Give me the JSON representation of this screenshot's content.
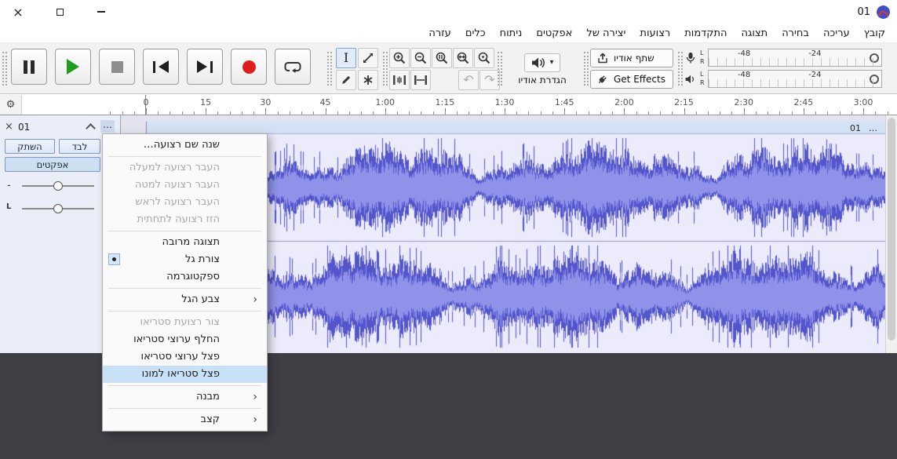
{
  "titlebar": {
    "document_title": "01",
    "close_glyph": "×"
  },
  "menubar": {
    "items": [
      "קובץ",
      "עריכה",
      "בחירה",
      "תצוגה",
      "התקדמות",
      "רצועות",
      "יצירה של",
      "אפקטים",
      "ניתוח",
      "כלים",
      "עזרה"
    ]
  },
  "toolbar": {
    "audio_setup_label": "הגדרת אודיו",
    "share_audio_label": "שתף אודיו",
    "get_effects_label": "Get Effects",
    "undo_glyph": "↶",
    "redo_glyph": "↷",
    "caret_glyph": "▾"
  },
  "meters": {
    "channels": [
      "L",
      "R"
    ],
    "scale": [
      "-48",
      "-24"
    ]
  },
  "timeline": {
    "gear_glyph": "⚙",
    "labels": [
      "0",
      "15",
      "30",
      "45",
      "1:00",
      "1:15",
      "1:30",
      "1:45",
      "2:00",
      "2:15",
      "2:30",
      "2:45",
      "3:00"
    ]
  },
  "track": {
    "close_glyph": "×",
    "name": "01",
    "menu_glyph": "…",
    "mute_label": "השתק",
    "solo_label": "לבד",
    "effects_label": "אפקטים",
    "gain_label": "-",
    "pan_label": "L",
    "clip": {
      "title": "01",
      "menu_glyph": "…"
    }
  },
  "context_menu": {
    "submenu_glyph": "›",
    "items": [
      {
        "label": "שנה שם רצועה…"
      },
      {
        "separator": true
      },
      {
        "label": "העבר רצועה למעלה",
        "disabled": true
      },
      {
        "label": "העבר רצועה למטה",
        "disabled": true
      },
      {
        "label": "העבר רצועה לראש",
        "disabled": true
      },
      {
        "label": "הזז רצועה לתחתית",
        "disabled": true
      },
      {
        "separator": true
      },
      {
        "label": "תצוגה מרובה"
      },
      {
        "label": "צורת גל",
        "radio": true
      },
      {
        "label": "ספקטוגרמה"
      },
      {
        "separator": true
      },
      {
        "label": "צבע הגל",
        "submenu": true
      },
      {
        "separator": true
      },
      {
        "label": "צור רצועת סטריאו",
        "disabled": true
      },
      {
        "label": "החלף ערוצי סטריאו"
      },
      {
        "label": "פצל ערוצי סטריאו"
      },
      {
        "label": "פצל סטריאו למונו",
        "highlighted": true
      },
      {
        "separator": true
      },
      {
        "label": "מבנה",
        "submenu": true
      },
      {
        "separator": true
      },
      {
        "label": "קצב",
        "submenu": true
      }
    ]
  },
  "colors": {
    "accent_highlight": "#c8e1f6",
    "waveform_peak": "#5355cd",
    "waveform_rms": "#8f92e8",
    "clip_background": "#ebebfb",
    "record_red": "#df1d1d",
    "play_green": "#1f9d1f",
    "dark_background": "#3f3f46"
  }
}
